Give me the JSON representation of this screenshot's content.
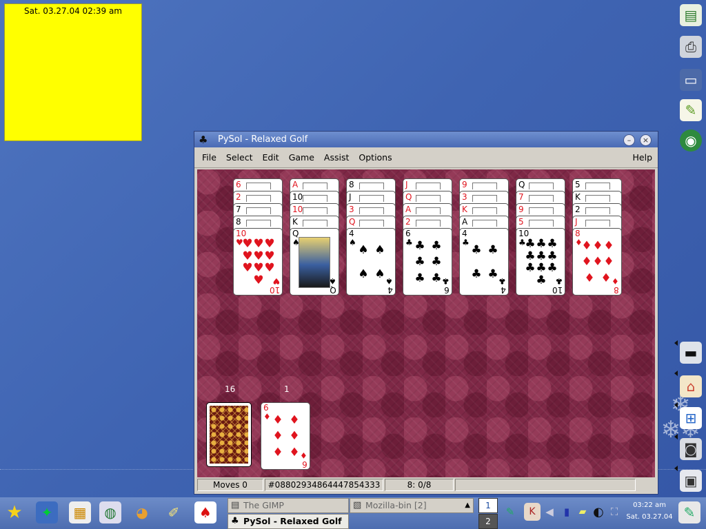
{
  "desktop": {
    "sticky_note": {
      "text": "Sat. 03.27.04 02:39 am",
      "color": "#ffff00"
    }
  },
  "window": {
    "title": "PySol - Relaxed Golf",
    "title_icon": "club-suit-icon",
    "controls": {
      "minimize": "–",
      "close": "×"
    },
    "menu": [
      "File",
      "Select",
      "Edit",
      "Game",
      "Assist",
      "Options"
    ],
    "help_label": "Help",
    "tableau": [
      {
        "peeks": [
          [
            "6",
            "r"
          ],
          [
            "2",
            "r"
          ],
          [
            "7",
            "b"
          ],
          [
            "8",
            "b"
          ]
        ],
        "top": {
          "rank": "10",
          "suit": "♥",
          "color": "r",
          "pips": 10
        }
      },
      {
        "peeks": [
          [
            "A",
            "r"
          ],
          [
            "10",
            "b"
          ],
          [
            "10",
            "r"
          ],
          [
            "K",
            "b"
          ]
        ],
        "top": {
          "rank": "Q",
          "suit": "♠",
          "color": "b",
          "face": true
        }
      },
      {
        "peeks": [
          [
            "8",
            "b"
          ],
          [
            "J",
            "b"
          ],
          [
            "3",
            "r"
          ],
          [
            "Q",
            "r"
          ]
        ],
        "top": {
          "rank": "4",
          "suit": "♠",
          "color": "b",
          "pips": 4
        }
      },
      {
        "peeks": [
          [
            "J",
            "r"
          ],
          [
            "Q",
            "r"
          ],
          [
            "A",
            "r"
          ],
          [
            "2",
            "r"
          ]
        ],
        "top": {
          "rank": "6",
          "suit": "♣",
          "color": "b",
          "pips": 6
        }
      },
      {
        "peeks": [
          [
            "9",
            "r"
          ],
          [
            "3",
            "r"
          ],
          [
            "K",
            "r"
          ],
          [
            "A",
            "b"
          ]
        ],
        "top": {
          "rank": "4",
          "suit": "♣",
          "color": "b",
          "pips": 4
        }
      },
      {
        "peeks": [
          [
            "Q",
            "b"
          ],
          [
            "7",
            "r"
          ],
          [
            "9",
            "r"
          ],
          [
            "5",
            "r"
          ]
        ],
        "top": {
          "rank": "10",
          "suit": "♣",
          "color": "b",
          "pips": 10
        }
      },
      {
        "peeks": [
          [
            "5",
            "b"
          ],
          [
            "K",
            "b"
          ],
          [
            "2",
            "b"
          ],
          [
            "J",
            "r"
          ]
        ],
        "top": {
          "rank": "8",
          "suit": "♦",
          "color": "r",
          "pips": 8
        }
      }
    ],
    "stock": {
      "count": "16"
    },
    "waste": {
      "count": "1",
      "rank": "6",
      "suit": "♦",
      "color": "r",
      "pips": 6
    },
    "status": {
      "moves": "Moves 0",
      "game_id": "#08802934864447854333",
      "progress": "8: 0/8",
      "blank": ""
    },
    "felt_color": "#7e2846"
  },
  "right_dock": {
    "icons": [
      "notepad-icon",
      "printer-icon",
      "monitor-icon",
      "edit-icon",
      "globe-icon",
      "terminal-icon",
      "home-icon",
      "windows-icon",
      "camera-icon",
      "floppy-icon"
    ]
  },
  "taskbar": {
    "launchers": [
      "star-icon",
      "lizard-icon",
      "files-icon",
      "globe-icon",
      "palette-icon",
      "brush-icon",
      "cards-icon"
    ],
    "tasks": [
      {
        "label": "The GIMP",
        "icon": "gimp-icon",
        "active": false
      },
      {
        "label": "Mozilla-bin [2]",
        "icon": "mozilla-icon",
        "active": false
      },
      {
        "label": "PySol - Relaxed Golf",
        "icon": "club-suit-icon",
        "active": true
      }
    ],
    "pager": [
      "1",
      "2"
    ],
    "tray": [
      "pen-icon",
      "k-icon",
      "speaker-icon",
      "cup-icon",
      "ticket-icon",
      "contrast-icon",
      "lock-icon"
    ],
    "clock": {
      "time": "03:22 am",
      "date": "Sat. 03.27.04"
    },
    "right_launcher": "pencil-edit-icon"
  }
}
